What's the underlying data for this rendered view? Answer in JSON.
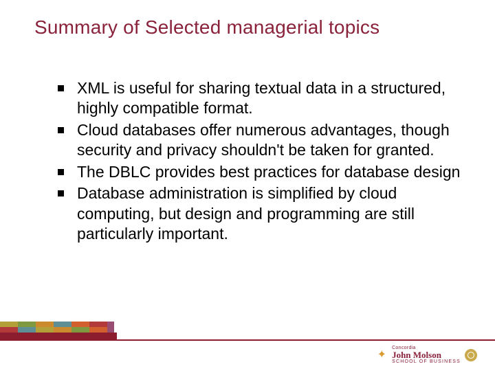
{
  "title": "Summary of Selected managerial topics",
  "bullets": [
    "XML is useful for sharing textual data in a structured, highly compatible format.",
    "Cloud databases offer numerous advantages, though security and privacy shouldn't be taken for granted.",
    "The DBLC provides best practices for database design",
    "Database administration is simplified by cloud computing, but design and programming are still particularly important."
  ],
  "logo": {
    "university": "Concordia",
    "name": "John Molson",
    "school": "SCHOOL OF BUSINESS"
  }
}
